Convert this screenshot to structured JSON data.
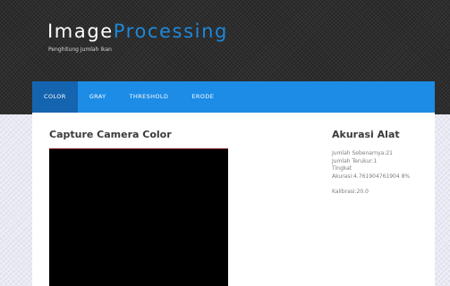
{
  "header": {
    "brand_part1": "Image",
    "brand_part2": "Processing",
    "subtitle": "Penghitung Jumlah Ikan"
  },
  "nav": {
    "tabs": [
      {
        "label": "COLOR",
        "active": true
      },
      {
        "label": "GRAY",
        "active": false
      },
      {
        "label": "THRESHOLD",
        "active": false
      },
      {
        "label": "ERODE",
        "active": false
      }
    ]
  },
  "main": {
    "title": "Capture Camera Color"
  },
  "sidebar": {
    "title": "Akurasi Alat",
    "jumlah_sebenarnya": "Jumlah Sebenarnya:21",
    "jumlah_terukur": "Jumlah Terukur:1",
    "tingkat": "Tingkat",
    "akurasi": "Akurasi:4.761904761904 8%",
    "kalibrasi": "Kalibrasi:20.0"
  },
  "colors": {
    "accent": "#1c8ce6",
    "active_tab": "#1564b0",
    "brand_highlight": "#1e88d9"
  }
}
